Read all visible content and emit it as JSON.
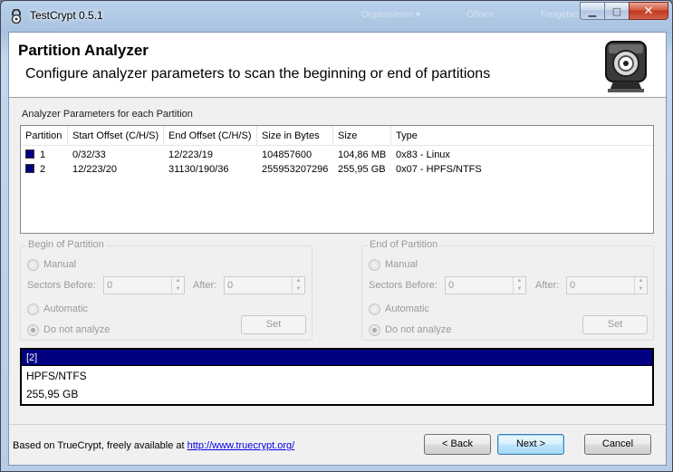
{
  "window": {
    "title": "TestCrypt 0.5.1"
  },
  "background_toolbar": {
    "item1": "Organisieren ▾",
    "item2": "Öffnen",
    "item3": "Freigeben"
  },
  "header": {
    "title": "Partition Analyzer",
    "subtitle": "Configure analyzer parameters to scan the beginning or end of partitions"
  },
  "partitions": {
    "group_label": "Analyzer Parameters for each Partition",
    "columns": [
      "Partition",
      "Start Offset (C/H/S)",
      "End Offset (C/H/S)",
      "Size in Bytes",
      "Size",
      "Type"
    ],
    "rows": [
      {
        "partition": "1",
        "start": "0/32/33",
        "end": "12/223/19",
        "bytes": "104857600",
        "size": "104,86 MB",
        "type": "0x83 - Linux",
        "color": "#000080"
      },
      {
        "partition": "2",
        "start": "12/223/20",
        "end": "31130/190/36",
        "bytes": "255953207296",
        "size": "255,95 GB",
        "type": "0x07 - HPFS/NTFS",
        "color": "#000080"
      }
    ]
  },
  "begin_group": {
    "title": "Begin of Partition",
    "manual": "Manual",
    "sectors_before_label": "Sectors Before:",
    "sectors_before_value": "0",
    "after_label": "After:",
    "after_value": "0",
    "automatic": "Automatic",
    "do_not_analyze": "Do not analyze",
    "set": "Set"
  },
  "end_group": {
    "title": "End of Partition",
    "manual": "Manual",
    "sectors_before_label": "Sectors Before:",
    "sectors_before_value": "0",
    "after_label": "After:",
    "after_value": "0",
    "automatic": "Automatic",
    "do_not_analyze": "Do not analyze",
    "set": "Set"
  },
  "info": {
    "selected": "[2]",
    "line1": "HPFS/NTFS",
    "line2": "255,95 GB"
  },
  "footer": {
    "text": "Based on TrueCrypt, freely available at ",
    "link": "http://www.truecrypt.org/",
    "back": "< Back",
    "next": "Next >",
    "cancel": "Cancel"
  }
}
